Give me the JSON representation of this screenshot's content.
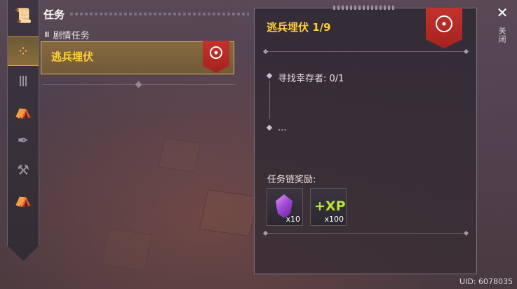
{
  "list": {
    "title": "任务",
    "category": "剧情任务",
    "items": [
      {
        "label": "逃兵埋伏"
      }
    ]
  },
  "detail": {
    "title": "逃兵埋伏 1/9",
    "objectives": [
      {
        "text": "寻找幸存者: 0/1"
      },
      {
        "text": "..."
      }
    ],
    "rewards_label": "任务链奖励:",
    "rewards": [
      {
        "icon": "purple-gem-icon",
        "qty": "x10"
      },
      {
        "icon": "xp-icon",
        "symbol": "+XP",
        "qty": "x100"
      }
    ]
  },
  "close": {
    "icon": "close-icon",
    "label": "关闭"
  },
  "uid": "UID: 6078035",
  "colors": {
    "accent": "#ffcf3a",
    "banner": "#c2332d",
    "xp": "#b8e43a"
  }
}
